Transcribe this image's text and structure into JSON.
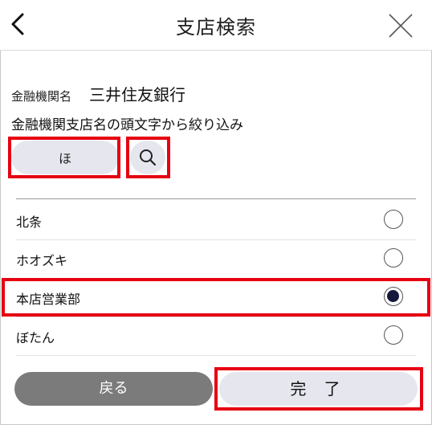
{
  "header": {
    "title": "支店検索",
    "back_icon": "chevron-left-icon",
    "close_icon": "close-x-icon"
  },
  "institution": {
    "label": "金融機関名",
    "value": "三井住友銀行"
  },
  "filter": {
    "caption": "金融機関支店名の頭文字から絞り込み",
    "value": "ほ",
    "search_icon": "search-icon"
  },
  "branches": [
    {
      "label": "北条",
      "selected": false
    },
    {
      "label": "ホオズキ",
      "selected": false
    },
    {
      "label": "本店営業部",
      "selected": true
    },
    {
      "label": "ぼたん",
      "selected": false
    }
  ],
  "footer": {
    "back_label": "戻る",
    "done_label": "完 了"
  },
  "colors": {
    "highlight": "#e60012",
    "radio_fill": "#14193c",
    "button_bg": "#e6e7ee",
    "back_bg": "#7b7b7b"
  }
}
